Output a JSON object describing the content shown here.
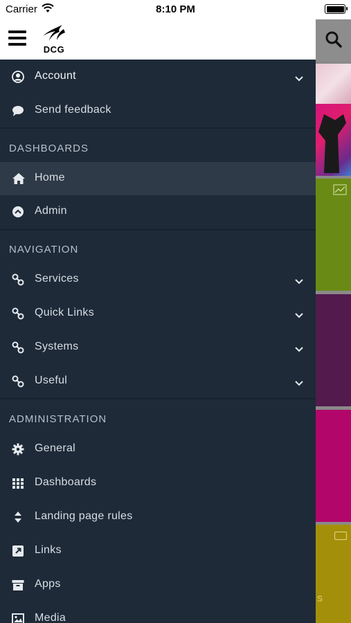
{
  "status_bar": {
    "carrier": "Carrier",
    "time": "8:10 PM"
  },
  "header": {
    "logo_text": "DCG"
  },
  "background": {
    "partial_text": "s"
  },
  "sidebar": {
    "top_items": [
      {
        "label": "Account",
        "icon": "user-circle-icon",
        "has_chevron": true
      },
      {
        "label": "Send feedback",
        "icon": "comment-icon",
        "has_chevron": false
      }
    ],
    "sections": [
      {
        "title": "DASHBOARDS",
        "items": [
          {
            "label": "Home",
            "icon": "home-icon",
            "active": true
          },
          {
            "label": "Admin",
            "icon": "chevron-up-circle-icon",
            "active": false
          }
        ]
      },
      {
        "title": "NAVIGATION",
        "items": [
          {
            "label": "Services",
            "icon": "link-icon",
            "has_chevron": true
          },
          {
            "label": "Quick Links",
            "icon": "link-icon",
            "has_chevron": true
          },
          {
            "label": "Systems",
            "icon": "link-icon",
            "has_chevron": true
          },
          {
            "label": "Useful",
            "icon": "link-icon",
            "has_chevron": true
          }
        ]
      },
      {
        "title": "ADMINISTRATION",
        "items": [
          {
            "label": "General",
            "icon": "gear-icon"
          },
          {
            "label": "Dashboards",
            "icon": "grid-icon"
          },
          {
            "label": "Landing page rules",
            "icon": "sort-icon"
          },
          {
            "label": "Links",
            "icon": "external-link-icon"
          },
          {
            "label": "Apps",
            "icon": "archive-icon"
          },
          {
            "label": "Media",
            "icon": "image-icon"
          }
        ]
      }
    ]
  },
  "colors": {
    "sidebar_bg": "#1e2a38",
    "active_item_bg": "#2e3a47",
    "text": "#d7dde4",
    "section_title": "#b7c0ca"
  }
}
